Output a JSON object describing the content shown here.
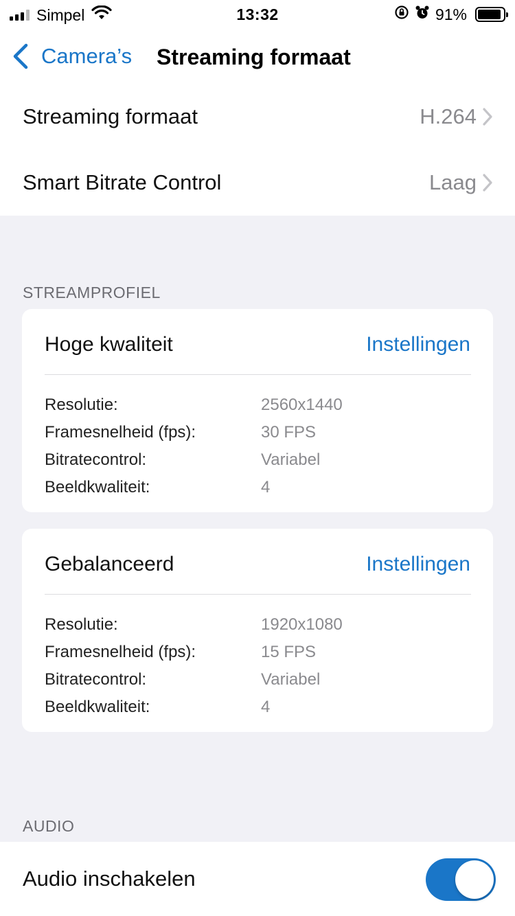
{
  "status_bar": {
    "carrier": "Simpel",
    "time": "13:32",
    "battery_percent": "91%",
    "battery_level": 0.91,
    "signal_bars_active": 3,
    "icons": [
      "signal-icon",
      "wifi-icon",
      "orientation-lock-icon",
      "alarm-icon",
      "battery-icon"
    ]
  },
  "nav": {
    "back_label": "Camera’s",
    "title": "Streaming formaat"
  },
  "settings": {
    "format_label": "Streaming formaat",
    "format_value": "H.264",
    "bitrate_label": "Smart Bitrate Control",
    "bitrate_value": "Laag"
  },
  "stream_profile": {
    "header": "STREAMPROFIEL",
    "profiles": [
      {
        "name": "Hoge kwaliteit",
        "settings_label": "Instellingen",
        "specs": [
          {
            "label": "Resolutie:",
            "value": "2560x1440"
          },
          {
            "label": "Framesnelheid (fps):",
            "value": "30 FPS"
          },
          {
            "label": "Bitratecontrol:",
            "value": "Variabel"
          },
          {
            "label": "Beeldkwaliteit:",
            "value": "4"
          }
        ]
      },
      {
        "name": "Gebalanceerd",
        "settings_label": "Instellingen",
        "specs": [
          {
            "label": "Resolutie:",
            "value": "1920x1080"
          },
          {
            "label": "Framesnelheid (fps):",
            "value": "15 FPS"
          },
          {
            "label": "Bitratecontrol:",
            "value": "Variabel"
          },
          {
            "label": "Beeldkwaliteit:",
            "value": "4"
          }
        ]
      }
    ]
  },
  "audio": {
    "header": "AUDIO",
    "enable_label": "Audio inschakelen",
    "enabled": true
  },
  "colors": {
    "accent": "#1a76c8",
    "background": "#f1f1f6",
    "secondary_text": "#8a8a8e"
  }
}
